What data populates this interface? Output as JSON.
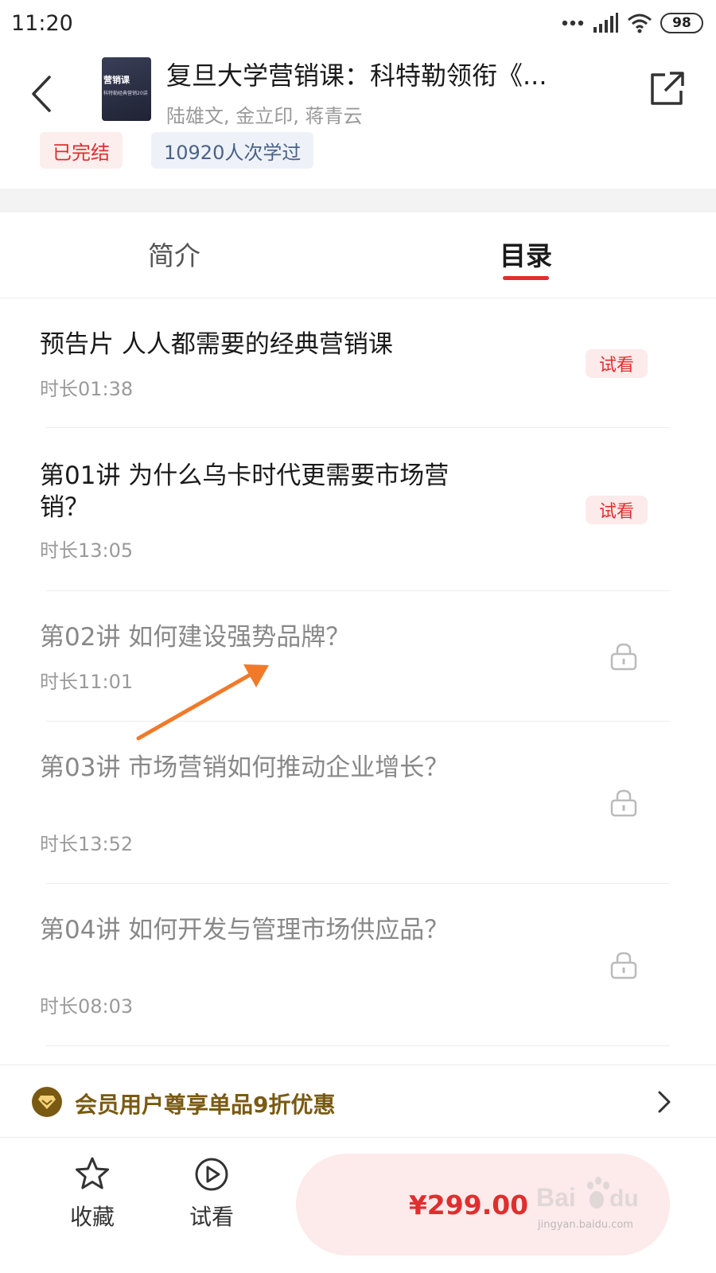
{
  "status_bar": {
    "time": "11:20",
    "battery": "98"
  },
  "header": {
    "title": "复旦大学营销课：科特勒领衔《...",
    "authors": "陆雄文, 金立印, 蒋青云",
    "cover": {
      "title": "营销课",
      "subtitle": "科特勒经典营销20讲"
    },
    "tag_status": "已完结",
    "tag_learners": "10920人次学过",
    "colors": {
      "accent": "#e02e2e",
      "tag_blue_bg": "#eef2f8"
    }
  },
  "tabs": [
    {
      "label": "简介",
      "active": false
    },
    {
      "label": "目录",
      "active": true
    }
  ],
  "lessons": [
    {
      "title": "预告片 人人都需要的经典营销课",
      "duration": "时长01:38",
      "locked": false,
      "badge": "试看"
    },
    {
      "title": "第01讲 为什么乌卡时代更需要市场营销？",
      "duration": "时长13:05",
      "locked": false,
      "badge": "试看"
    },
    {
      "title": "第02讲 如何建设强势品牌？",
      "duration": "时长11:01",
      "locked": true,
      "icon": "lock-icon"
    },
    {
      "title": "第03讲 市场营销如何推动企业增长？",
      "duration": "时长13:52",
      "locked": true,
      "icon": "lock-icon"
    },
    {
      "title": "第04讲 如何开发与管理市场供应品？",
      "duration": "时长08:03",
      "locked": true,
      "icon": "lock-icon"
    }
  ],
  "member_bar": {
    "text": "会员用户尊享单品9折优惠",
    "icon": "vip-diamond-icon"
  },
  "bottom_bar": {
    "favorite_label": "收藏",
    "trial_label": "试看",
    "price": "¥299.00"
  },
  "watermark": {
    "brand": "Baidu经验",
    "url": "jingyan.baidu.com"
  }
}
